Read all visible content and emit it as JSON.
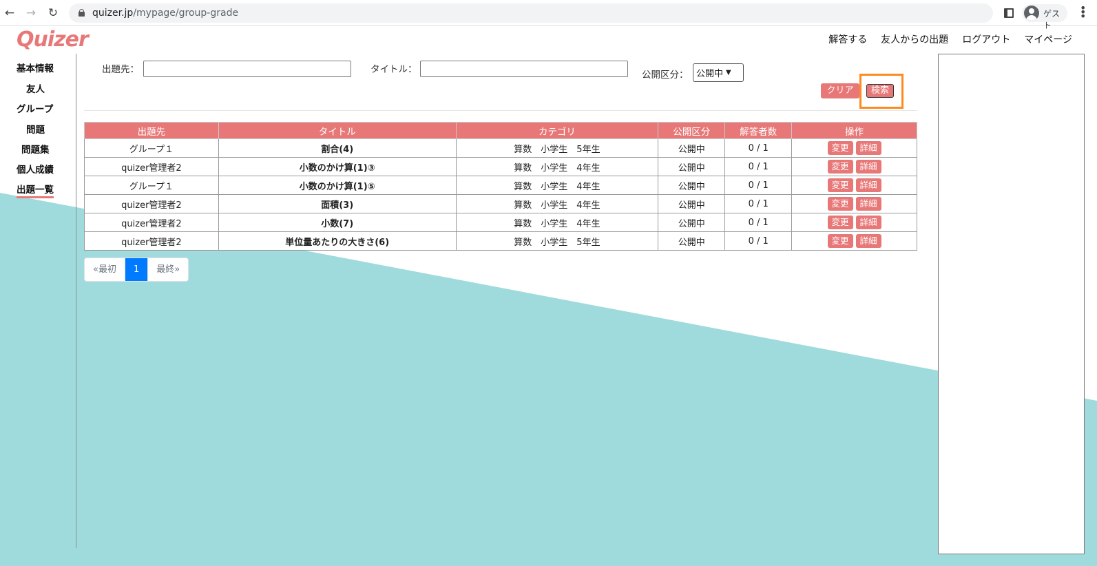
{
  "browser": {
    "url_host": "quizer.jp",
    "url_path": "/mypage/group-grade",
    "profile_label": "ゲスト"
  },
  "header": {
    "logo": "Quizer",
    "nav": [
      {
        "label": "解答する"
      },
      {
        "label": "友人からの出題"
      },
      {
        "label": "ログアウト"
      },
      {
        "label": "マイページ"
      }
    ]
  },
  "sidebar": {
    "items": [
      {
        "label": "基本情報"
      },
      {
        "label": "友人"
      },
      {
        "label": "グループ"
      },
      {
        "label": "問題"
      },
      {
        "label": "問題集"
      },
      {
        "label": "個人成績"
      },
      {
        "label": "出題一覧",
        "active": true
      }
    ]
  },
  "search": {
    "target_label": "出題先：",
    "target_value": "",
    "title_label": "タイトル：",
    "title_value": "",
    "public_label": "公開区分：",
    "public_selected": "公開中",
    "clear_label": "クリア",
    "search_label": "検索"
  },
  "table": {
    "headers": [
      "出題先",
      "タイトル",
      "カテゴリ",
      "公開区分",
      "解答者数",
      "操作"
    ],
    "rows": [
      {
        "target": "グループ１",
        "title": "割合(4)",
        "category": "算数　小学生　5年生",
        "status": "公開中",
        "count": "0 / 1"
      },
      {
        "target": "quizer管理者2",
        "title": "小数のかけ算(1)③",
        "category": "算数　小学生　4年生",
        "status": "公開中",
        "count": "0 / 1"
      },
      {
        "target": "グループ１",
        "title": "小数のかけ算(1)⑤",
        "category": "算数　小学生　4年生",
        "status": "公開中",
        "count": "0 / 1"
      },
      {
        "target": "quizer管理者2",
        "title": "面積(3)",
        "category": "算数　小学生　4年生",
        "status": "公開中",
        "count": "0 / 1"
      },
      {
        "target": "quizer管理者2",
        "title": "小数(7)",
        "category": "算数　小学生　4年生",
        "status": "公開中",
        "count": "0 / 1"
      },
      {
        "target": "quizer管理者2",
        "title": "単位量あたりの大きさ(6)",
        "category": "算数　小学生　5年生",
        "status": "公開中",
        "count": "0 / 1"
      }
    ],
    "edit_label": "変更",
    "detail_label": "詳細"
  },
  "pagination": {
    "first": "«最初",
    "current": "1",
    "last": "最終»"
  },
  "colors": {
    "accent": "#e87878",
    "teal_bg": "#9fdbdc",
    "highlight": "#ff8a1e",
    "pager_active": "#007bff"
  }
}
